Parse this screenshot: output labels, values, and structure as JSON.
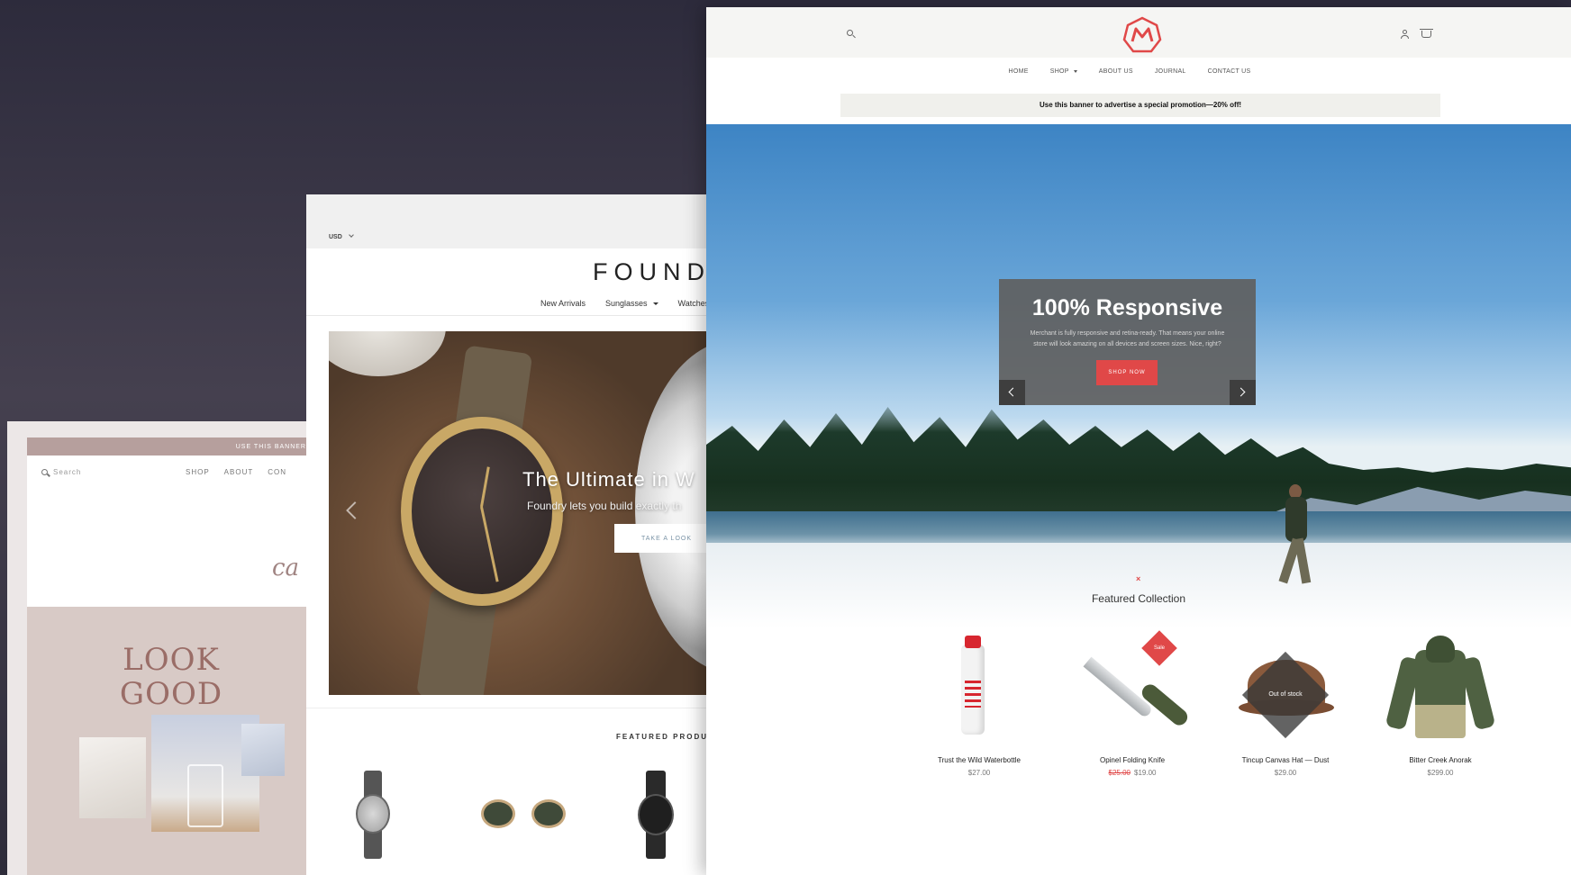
{
  "left_theme": {
    "banner_text": "USE THIS BANNER",
    "search_placeholder": "Search",
    "nav": [
      "SHOP",
      "ABOUT",
      "CON"
    ],
    "script_text": "ca",
    "hero_title": "LOOK GOOD"
  },
  "middle_theme": {
    "currency": "USD",
    "brand": "FOUNDR",
    "nav": [
      "New Arrivals",
      "Sunglasses",
      "Watches"
    ],
    "hero_headline": "The Ultimate in W",
    "hero_subtext": "Foundry lets you build exactly th",
    "hero_button": "TAKE A LOOK",
    "featured_heading": "FEATURED PRODUCT"
  },
  "right_theme": {
    "nav": [
      "HOME",
      "SHOP",
      "ABOUT US",
      "JOURNAL",
      "CONTACT US"
    ],
    "promo_banner": "Use this banner to advertise a special promotion—20% off!",
    "slide": {
      "title": "100% Responsive",
      "text": "Merchant is fully responsive and retina-ready. That means your online store will look amazing on all devices and screen sizes. Nice, right?",
      "button": "SHOP NOW"
    },
    "section_marker": "×",
    "featured_title": "Featured Collection",
    "sale_badge": "Sale",
    "out_of_stock_badge": "Out of stock",
    "products": [
      {
        "name": "Trust the Wild Waterbottle",
        "price": "$27.00",
        "compare_price": ""
      },
      {
        "name": "Opinel Folding Knife",
        "price": "$19.00",
        "compare_price": "$25.00"
      },
      {
        "name": "Tincup Canvas Hat — Dust",
        "price": "$29.00",
        "compare_price": ""
      },
      {
        "name": "Bitter Creek Anorak",
        "price": "$299.00",
        "compare_price": ""
      }
    ],
    "accent_color": "#e04848"
  }
}
